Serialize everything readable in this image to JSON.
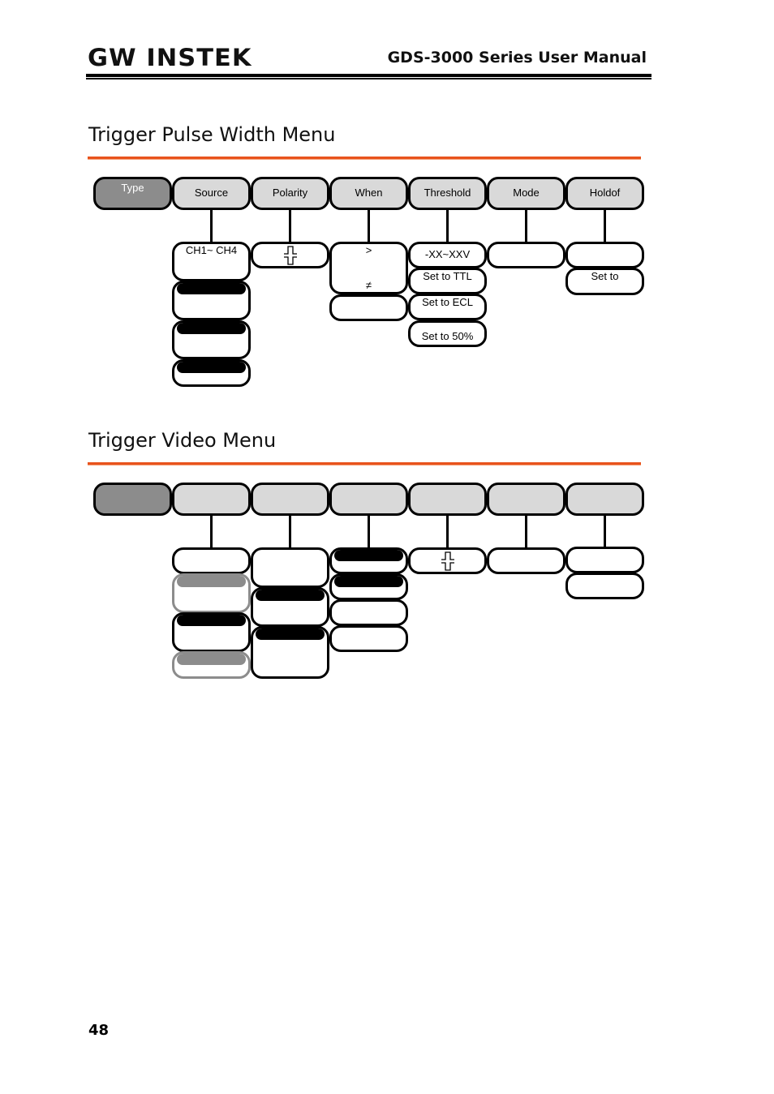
{
  "header": {
    "logo": "GW INSTEK",
    "title": "GDS-3000 Series User Manual"
  },
  "sections": [
    {
      "title": "Trigger Pulse Width Menu",
      "top_menu": [
        "Type",
        "Source",
        "Polarity",
        "When",
        "Threshold",
        "Mode",
        "Holdof"
      ],
      "source_options": [
        "CH1~ CH4",
        "",
        "",
        ""
      ],
      "polarity_icon": "pulse-polarity-icon",
      "when_options": [
        ">",
        "≠",
        ""
      ],
      "threshold_options": [
        "-XX~XXV",
        "Set to TTL",
        "Set to ECL",
        "Set to 50%"
      ],
      "mode_options": [
        ""
      ],
      "holdoff_options": [
        "",
        "Set to"
      ]
    },
    {
      "title": "Trigger Video Menu",
      "polarity_icon": "pulse-polarity-icon"
    }
  ],
  "page_number": "48",
  "colors": {
    "accent_rule": "#e8531c",
    "type_button": "#8c8c8c",
    "menu_button": "#d9d9d9"
  }
}
